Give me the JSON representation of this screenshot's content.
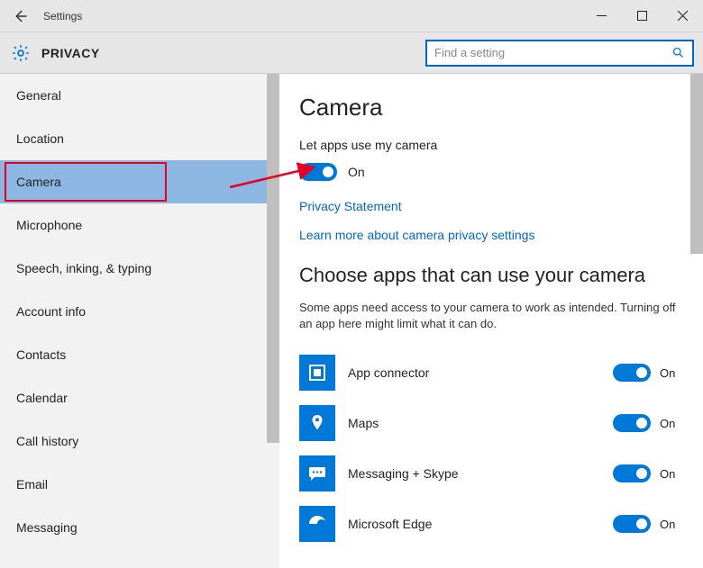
{
  "window": {
    "title": "Settings"
  },
  "header": {
    "title": "PRIVACY",
    "search_placeholder": "Find a setting"
  },
  "sidebar": {
    "items": [
      {
        "label": "General"
      },
      {
        "label": "Location"
      },
      {
        "label": "Camera",
        "selected": true
      },
      {
        "label": "Microphone"
      },
      {
        "label": "Speech, inking, & typing"
      },
      {
        "label": "Account info"
      },
      {
        "label": "Contacts"
      },
      {
        "label": "Calendar"
      },
      {
        "label": "Call history"
      },
      {
        "label": "Email"
      },
      {
        "label": "Messaging"
      }
    ]
  },
  "content": {
    "page_title": "Camera",
    "master_toggle": {
      "label": "Let apps use my camera",
      "state": "On",
      "on": true
    },
    "links": {
      "privacy_statement": "Privacy Statement",
      "learn_more": "Learn more about camera privacy settings"
    },
    "apps_section": {
      "heading": "Choose apps that can use your camera",
      "description": "Some apps need access to your camera to work as intended. Turning off an app here might limit what it can do.",
      "apps": [
        {
          "name": "App connector",
          "state": "On",
          "icon": "app-connector"
        },
        {
          "name": "Maps",
          "state": "On",
          "icon": "maps"
        },
        {
          "name": "Messaging + Skype",
          "state": "On",
          "icon": "messaging"
        },
        {
          "name": "Microsoft Edge",
          "state": "On",
          "icon": "edge"
        }
      ]
    }
  },
  "colors": {
    "accent": "#0078d7",
    "highlight_border": "#e60026",
    "selected_bg": "#8db7e3",
    "link": "#0066cc"
  }
}
